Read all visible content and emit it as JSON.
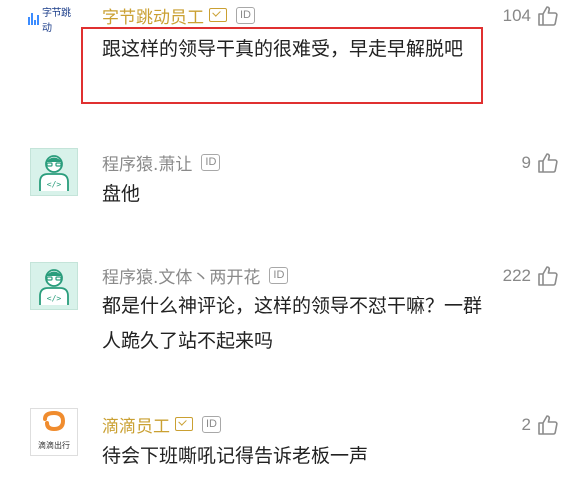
{
  "comments": [
    {
      "author": "字节跳动员工",
      "verified": true,
      "id_badge": "ID",
      "likes": "104",
      "text": "跟这样的领导干真的很难受，早走早解脱吧",
      "avatar": {
        "type": "logo",
        "brand_text": "字节跳动",
        "icon": "bytedance-logo-icon"
      }
    },
    {
      "author": "程序猿.萧让",
      "verified": false,
      "id_badge": "ID",
      "likes": "9",
      "text": "盘他",
      "avatar": {
        "type": "coder",
        "icon": "coder-avatar-icon"
      }
    },
    {
      "author": "程序猿.文体丶两开花",
      "verified": false,
      "id_badge": "ID",
      "likes": "222",
      "text": "都是什么神评论，这样的领导不怼干嘛？一群人跪久了站不起来吗",
      "avatar": {
        "type": "coder",
        "icon": "coder-avatar-icon"
      }
    },
    {
      "author": "滴滴员工",
      "verified": true,
      "id_badge": "ID",
      "likes": "2",
      "text": "待会下班嘶吼记得告诉老板一声",
      "avatar": {
        "type": "logo",
        "brand_text": "滴滴出行",
        "icon": "didi-logo-icon"
      }
    }
  ],
  "colors": {
    "highlight": "#e03030",
    "verified_name": "#caa032",
    "name": "#8a8a8a",
    "text": "#222222",
    "avatar_bg": "#d8f2ea",
    "didi_orange": "#f08c2e"
  }
}
